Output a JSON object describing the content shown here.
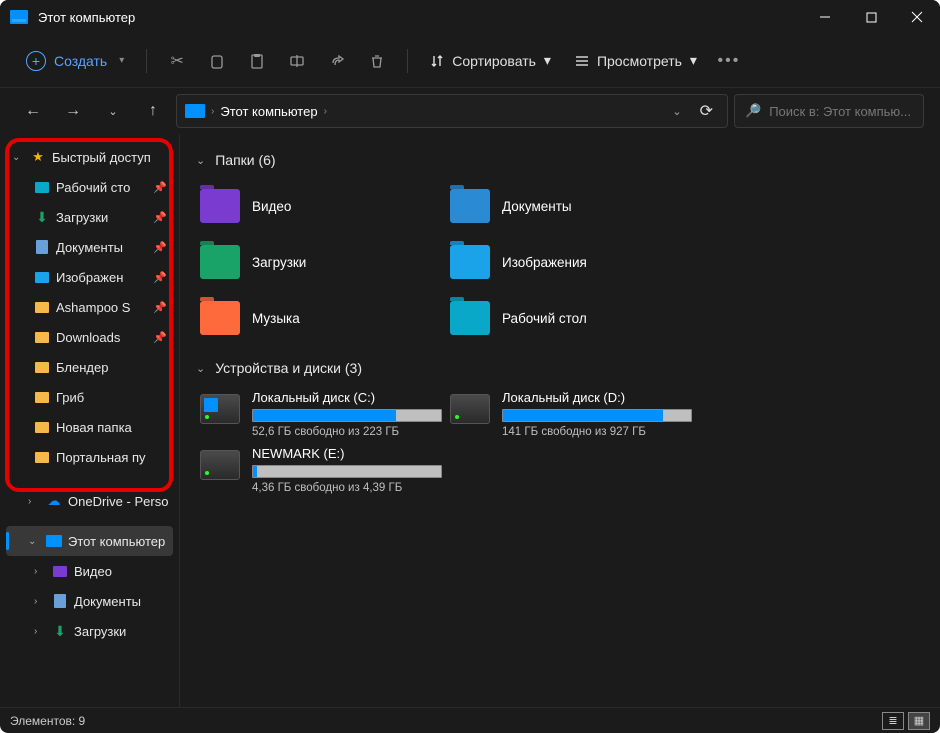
{
  "window": {
    "title": "Этот компьютер"
  },
  "toolbar": {
    "create": "Создать",
    "sort": "Сортировать",
    "view": "Просмотреть"
  },
  "breadcrumb": {
    "location": "Этот компьютер"
  },
  "search": {
    "placeholder": "Поиск в: Этот компью..."
  },
  "sidebar": {
    "quick_access": "Быстрый доступ",
    "items": [
      {
        "label": "Рабочий сто",
        "pinned": true,
        "icon": "desktop"
      },
      {
        "label": "Загрузки",
        "pinned": true,
        "icon": "downloads"
      },
      {
        "label": "Документы",
        "pinned": true,
        "icon": "documents"
      },
      {
        "label": "Изображен",
        "pinned": true,
        "icon": "pictures"
      },
      {
        "label": "Ashampoo S",
        "pinned": true,
        "icon": "folder"
      },
      {
        "label": "Downloads",
        "pinned": true,
        "icon": "folder"
      },
      {
        "label": "Блендер",
        "pinned": false,
        "icon": "folder"
      },
      {
        "label": "Гриб",
        "pinned": false,
        "icon": "folder"
      },
      {
        "label": "Новая папка",
        "pinned": false,
        "icon": "folder"
      },
      {
        "label": "Портальная пу",
        "pinned": false,
        "icon": "folder"
      }
    ],
    "onedrive": "OneDrive - Perso",
    "this_pc": "Этот компьютер",
    "pc_children": [
      {
        "label": "Видео"
      },
      {
        "label": "Документы"
      },
      {
        "label": "Загрузки"
      }
    ]
  },
  "sections": {
    "folders_title": "Папки (6)",
    "folders": [
      {
        "label": "Видео",
        "color": "#7a3bd1"
      },
      {
        "label": "Документы",
        "color": "#2a8ad4"
      },
      {
        "label": "Загрузки",
        "color": "#1aa368"
      },
      {
        "label": "Изображения",
        "color": "#1aa3e8"
      },
      {
        "label": "Музыка",
        "color": "#ff6a3d"
      },
      {
        "label": "Рабочий стол",
        "color": "#0aa8c8"
      }
    ],
    "drives_title": "Устройства и диски (3)",
    "drives": [
      {
        "name": "Локальный диск (C:)",
        "free_text": "52,6 ГБ свободно из 223 ГБ",
        "fill_pct": 76,
        "win": true
      },
      {
        "name": "Локальный диск (D:)",
        "free_text": "141 ГБ свободно из 927 ГБ",
        "fill_pct": 85,
        "win": false
      },
      {
        "name": "NEWMARK (E:)",
        "free_text": "4,36 ГБ свободно из 4,39 ГБ",
        "fill_pct": 2,
        "win": false
      }
    ]
  },
  "status": {
    "text": "Элементов: 9"
  }
}
